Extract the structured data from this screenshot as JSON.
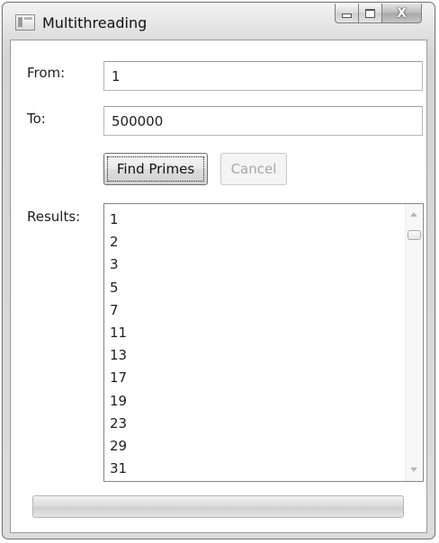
{
  "window": {
    "title": "Multithreading",
    "close_glyph": "X"
  },
  "icons": {
    "app": "app-window-icon",
    "minimize": "minimize-icon",
    "maximize": "maximize-icon",
    "close": "close-icon",
    "scroll_up": "scroll-up-arrow-icon",
    "scroll_down": "scroll-down-arrow-icon"
  },
  "form": {
    "from_label": "From:",
    "from_value": "1",
    "to_label": "To:",
    "to_value": "500000",
    "find_button": "Find Primes",
    "cancel_button": "Cancel",
    "results_label": "Results:"
  },
  "results": [
    "1",
    "2",
    "3",
    "5",
    "7",
    "11",
    "13",
    "17",
    "19",
    "23",
    "29",
    "31"
  ],
  "progress": {
    "value": 0
  },
  "colors": {
    "window_border": "#7a7a7a",
    "disabled_text": "#a8a8a8",
    "listbox_border": "#828790"
  }
}
